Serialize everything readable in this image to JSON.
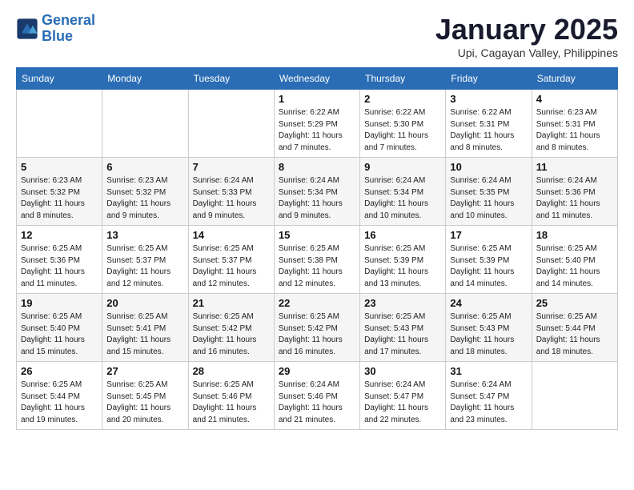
{
  "header": {
    "logo_line1": "General",
    "logo_line2": "Blue",
    "month_title": "January 2025",
    "subtitle": "Upi, Cagayan Valley, Philippines"
  },
  "weekdays": [
    "Sunday",
    "Monday",
    "Tuesday",
    "Wednesday",
    "Thursday",
    "Friday",
    "Saturday"
  ],
  "weeks": [
    [
      {
        "day": "",
        "sunrise": "",
        "sunset": "",
        "daylight": ""
      },
      {
        "day": "",
        "sunrise": "",
        "sunset": "",
        "daylight": ""
      },
      {
        "day": "",
        "sunrise": "",
        "sunset": "",
        "daylight": ""
      },
      {
        "day": "1",
        "sunrise": "Sunrise: 6:22 AM",
        "sunset": "Sunset: 5:29 PM",
        "daylight": "Daylight: 11 hours and 7 minutes."
      },
      {
        "day": "2",
        "sunrise": "Sunrise: 6:22 AM",
        "sunset": "Sunset: 5:30 PM",
        "daylight": "Daylight: 11 hours and 7 minutes."
      },
      {
        "day": "3",
        "sunrise": "Sunrise: 6:22 AM",
        "sunset": "Sunset: 5:31 PM",
        "daylight": "Daylight: 11 hours and 8 minutes."
      },
      {
        "day": "4",
        "sunrise": "Sunrise: 6:23 AM",
        "sunset": "Sunset: 5:31 PM",
        "daylight": "Daylight: 11 hours and 8 minutes."
      }
    ],
    [
      {
        "day": "5",
        "sunrise": "Sunrise: 6:23 AM",
        "sunset": "Sunset: 5:32 PM",
        "daylight": "Daylight: 11 hours and 8 minutes."
      },
      {
        "day": "6",
        "sunrise": "Sunrise: 6:23 AM",
        "sunset": "Sunset: 5:32 PM",
        "daylight": "Daylight: 11 hours and 9 minutes."
      },
      {
        "day": "7",
        "sunrise": "Sunrise: 6:24 AM",
        "sunset": "Sunset: 5:33 PM",
        "daylight": "Daylight: 11 hours and 9 minutes."
      },
      {
        "day": "8",
        "sunrise": "Sunrise: 6:24 AM",
        "sunset": "Sunset: 5:34 PM",
        "daylight": "Daylight: 11 hours and 9 minutes."
      },
      {
        "day": "9",
        "sunrise": "Sunrise: 6:24 AM",
        "sunset": "Sunset: 5:34 PM",
        "daylight": "Daylight: 11 hours and 10 minutes."
      },
      {
        "day": "10",
        "sunrise": "Sunrise: 6:24 AM",
        "sunset": "Sunset: 5:35 PM",
        "daylight": "Daylight: 11 hours and 10 minutes."
      },
      {
        "day": "11",
        "sunrise": "Sunrise: 6:24 AM",
        "sunset": "Sunset: 5:36 PM",
        "daylight": "Daylight: 11 hours and 11 minutes."
      }
    ],
    [
      {
        "day": "12",
        "sunrise": "Sunrise: 6:25 AM",
        "sunset": "Sunset: 5:36 PM",
        "daylight": "Daylight: 11 hours and 11 minutes."
      },
      {
        "day": "13",
        "sunrise": "Sunrise: 6:25 AM",
        "sunset": "Sunset: 5:37 PM",
        "daylight": "Daylight: 11 hours and 12 minutes."
      },
      {
        "day": "14",
        "sunrise": "Sunrise: 6:25 AM",
        "sunset": "Sunset: 5:37 PM",
        "daylight": "Daylight: 11 hours and 12 minutes."
      },
      {
        "day": "15",
        "sunrise": "Sunrise: 6:25 AM",
        "sunset": "Sunset: 5:38 PM",
        "daylight": "Daylight: 11 hours and 12 minutes."
      },
      {
        "day": "16",
        "sunrise": "Sunrise: 6:25 AM",
        "sunset": "Sunset: 5:39 PM",
        "daylight": "Daylight: 11 hours and 13 minutes."
      },
      {
        "day": "17",
        "sunrise": "Sunrise: 6:25 AM",
        "sunset": "Sunset: 5:39 PM",
        "daylight": "Daylight: 11 hours and 14 minutes."
      },
      {
        "day": "18",
        "sunrise": "Sunrise: 6:25 AM",
        "sunset": "Sunset: 5:40 PM",
        "daylight": "Daylight: 11 hours and 14 minutes."
      }
    ],
    [
      {
        "day": "19",
        "sunrise": "Sunrise: 6:25 AM",
        "sunset": "Sunset: 5:40 PM",
        "daylight": "Daylight: 11 hours and 15 minutes."
      },
      {
        "day": "20",
        "sunrise": "Sunrise: 6:25 AM",
        "sunset": "Sunset: 5:41 PM",
        "daylight": "Daylight: 11 hours and 15 minutes."
      },
      {
        "day": "21",
        "sunrise": "Sunrise: 6:25 AM",
        "sunset": "Sunset: 5:42 PM",
        "daylight": "Daylight: 11 hours and 16 minutes."
      },
      {
        "day": "22",
        "sunrise": "Sunrise: 6:25 AM",
        "sunset": "Sunset: 5:42 PM",
        "daylight": "Daylight: 11 hours and 16 minutes."
      },
      {
        "day": "23",
        "sunrise": "Sunrise: 6:25 AM",
        "sunset": "Sunset: 5:43 PM",
        "daylight": "Daylight: 11 hours and 17 minutes."
      },
      {
        "day": "24",
        "sunrise": "Sunrise: 6:25 AM",
        "sunset": "Sunset: 5:43 PM",
        "daylight": "Daylight: 11 hours and 18 minutes."
      },
      {
        "day": "25",
        "sunrise": "Sunrise: 6:25 AM",
        "sunset": "Sunset: 5:44 PM",
        "daylight": "Daylight: 11 hours and 18 minutes."
      }
    ],
    [
      {
        "day": "26",
        "sunrise": "Sunrise: 6:25 AM",
        "sunset": "Sunset: 5:44 PM",
        "daylight": "Daylight: 11 hours and 19 minutes."
      },
      {
        "day": "27",
        "sunrise": "Sunrise: 6:25 AM",
        "sunset": "Sunset: 5:45 PM",
        "daylight": "Daylight: 11 hours and 20 minutes."
      },
      {
        "day": "28",
        "sunrise": "Sunrise: 6:25 AM",
        "sunset": "Sunset: 5:46 PM",
        "daylight": "Daylight: 11 hours and 21 minutes."
      },
      {
        "day": "29",
        "sunrise": "Sunrise: 6:24 AM",
        "sunset": "Sunset: 5:46 PM",
        "daylight": "Daylight: 11 hours and 21 minutes."
      },
      {
        "day": "30",
        "sunrise": "Sunrise: 6:24 AM",
        "sunset": "Sunset: 5:47 PM",
        "daylight": "Daylight: 11 hours and 22 minutes."
      },
      {
        "day": "31",
        "sunrise": "Sunrise: 6:24 AM",
        "sunset": "Sunset: 5:47 PM",
        "daylight": "Daylight: 11 hours and 23 minutes."
      },
      {
        "day": "",
        "sunrise": "",
        "sunset": "",
        "daylight": ""
      }
    ]
  ]
}
